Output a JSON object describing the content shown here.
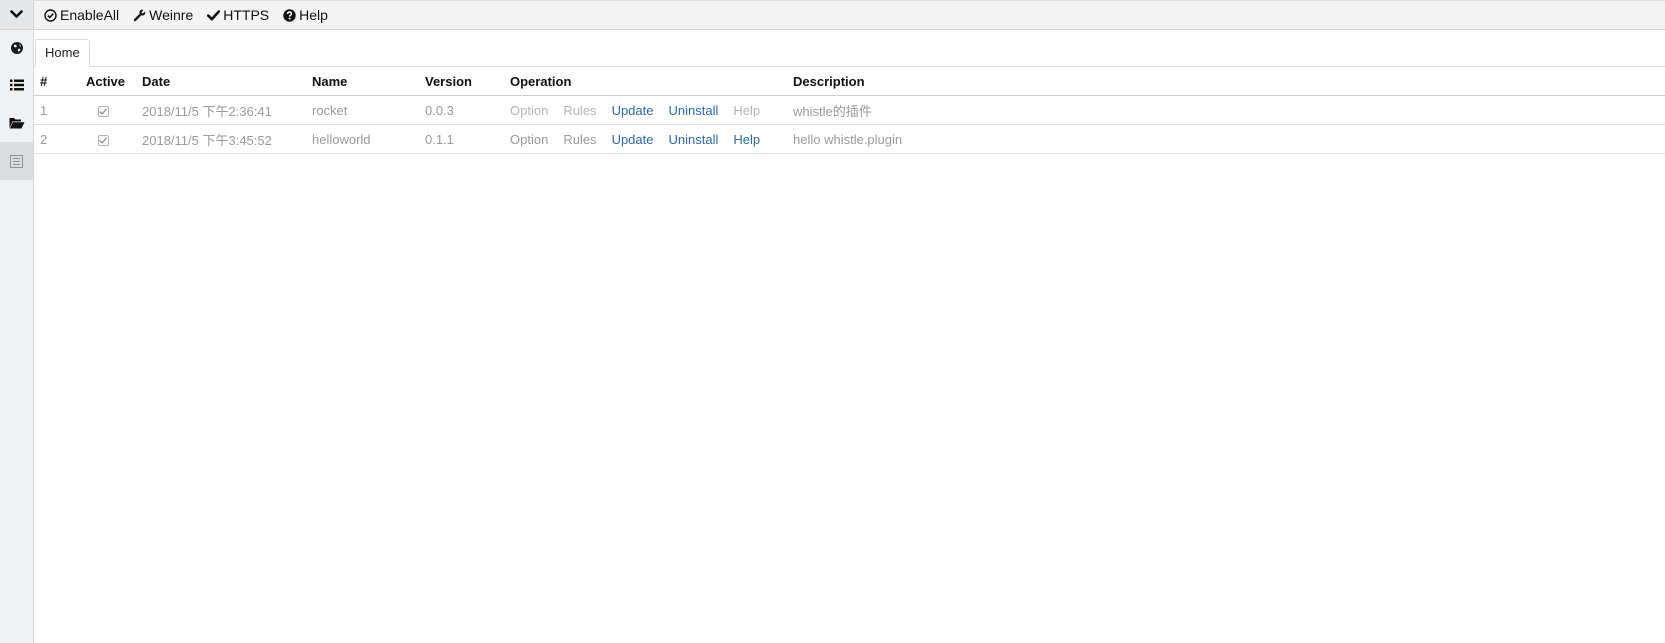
{
  "toolbar": {
    "enable_all": "EnableAll",
    "weinre": "Weinre",
    "https": "HTTPS",
    "help": "Help"
  },
  "sidebar": {
    "items": [
      {
        "icon": "globe-icon"
      },
      {
        "icon": "list-icon"
      },
      {
        "icon": "folder-open-icon"
      },
      {
        "icon": "plugins-icon",
        "active": true
      }
    ]
  },
  "tabs": [
    {
      "label": "Home",
      "active": true
    }
  ],
  "table": {
    "columns": [
      "#",
      "Active",
      "Date",
      "Name",
      "Version",
      "Operation",
      "Description"
    ],
    "rows": [
      {
        "index": "1",
        "active": true,
        "date": "2018/11/5 下午2:36:41",
        "name": "rocket",
        "version": "0.0.3",
        "ops": {
          "option": "Option",
          "rules": "Rules",
          "update": "Update",
          "uninstall": "Uninstall",
          "help": "Help"
        },
        "description": "whistle的插件"
      },
      {
        "index": "2",
        "active": true,
        "date": "2018/11/5 下午3:45:52",
        "name": "helloworld",
        "version": "0.1.1",
        "ops": {
          "option": "Option",
          "rules": "Rules",
          "update": "Update",
          "uninstall": "Uninstall",
          "help": "Help"
        },
        "description": "hello whistle.plugin"
      }
    ]
  },
  "colors": {
    "link": "#2a6aa9",
    "muted": "#9a9a9a",
    "disabled": "#b4b4b4",
    "rail_bg": "#f0f1f2"
  }
}
